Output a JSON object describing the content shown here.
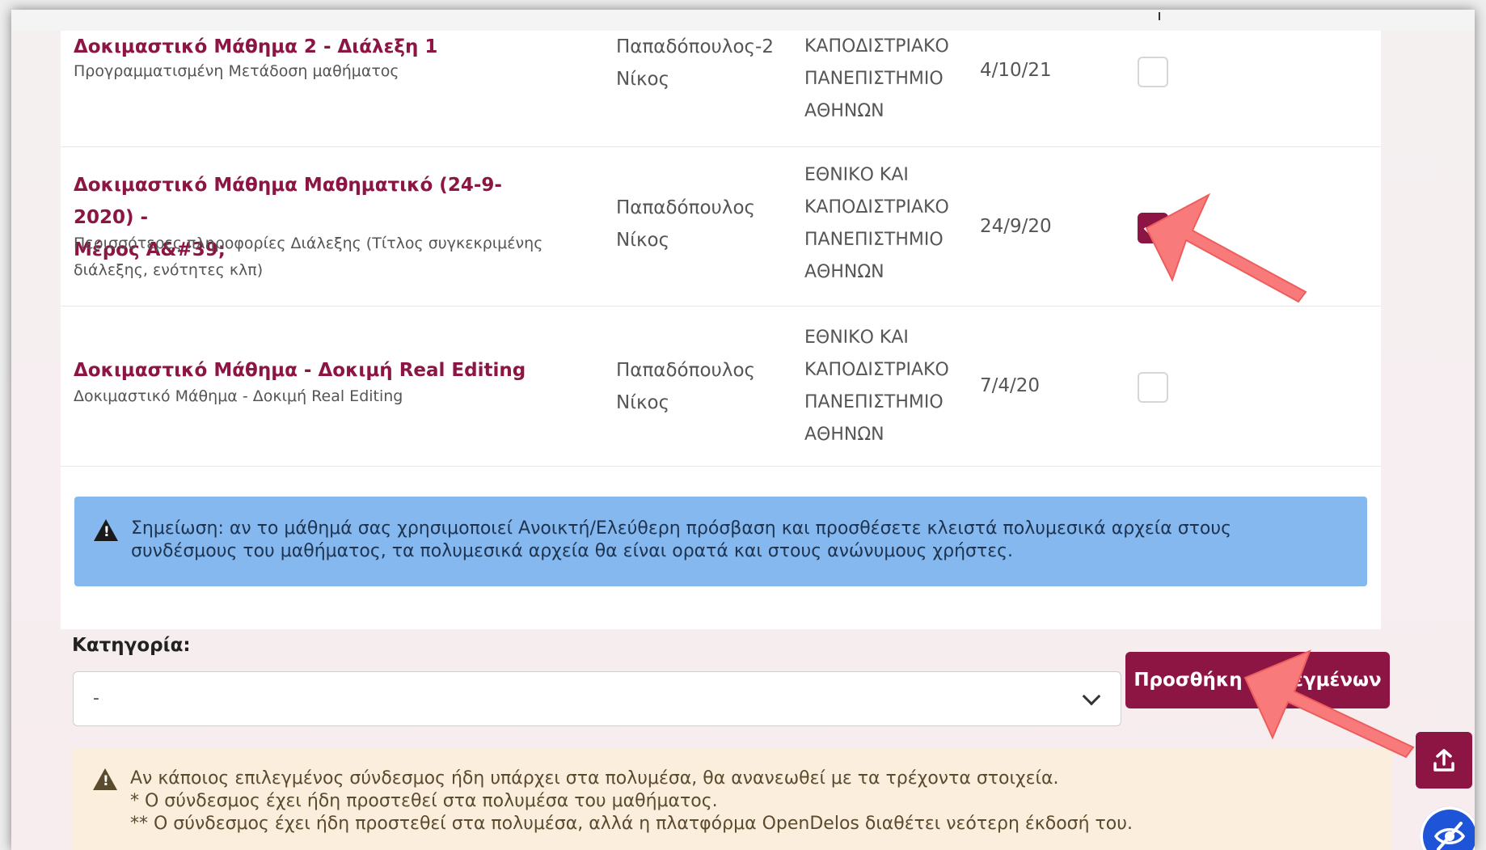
{
  "lectures": [
    {
      "title": "Δοκιμαστικό Μάθημα 2 - Διάλεξη 1",
      "description": "Προγραμματισμένη Μετάδοση μαθήματος",
      "author_lines": [
        "Παπαδόπουλος-2",
        "Νίκος"
      ],
      "institution_lines": [
        "ΚΑΠΟΔΙΣΤΡΙΑΚΟ",
        "ΠΑΝΕΠΙΣΤΗΜΙΟ",
        "ΑΘΗΝΩΝ"
      ],
      "date": "4/10/21",
      "selected": false
    },
    {
      "title_lines": [
        "Δοκιμαστικό Μάθημα Μαθηματικό (24-9-2020) -",
        "Μέρος A&#39;"
      ],
      "description_lines": [
        "Περισσότερες πληροφορίες Διάλεξης (Τίτλος συγκεκριμένης",
        "διάλεξης, ενότητες κλπ)"
      ],
      "author_lines": [
        "Παπαδόπουλος",
        "Νίκος"
      ],
      "institution_lines": [
        "ΕΘΝΙΚΟ ΚΑΙ",
        "ΚΑΠΟΔΙΣΤΡΙΑΚΟ",
        "ΠΑΝΕΠΙΣΤΗΜΙΟ",
        "ΑΘΗΝΩΝ"
      ],
      "date": "24/9/20",
      "selected": true
    },
    {
      "title": "Δοκιμαστικό Μάθημα - Δοκιμή Real Editing",
      "description": "Δοκιμαστικό Μάθημα - Δοκιμή Real Editing",
      "author_lines": [
        "Παπαδόπουλος",
        "Νίκος"
      ],
      "institution_lines": [
        "ΕΘΝΙΚΟ ΚΑΙ",
        "ΚΑΠΟΔΙΣΤΡΙΑΚΟ",
        "ΠΑΝΕΠΙΣΤΗΜΙΟ",
        "ΑΘΗΝΩΝ"
      ],
      "date": "7/4/20",
      "selected": false
    }
  ],
  "info_note": {
    "line1": "Σημείωση: αν το μάθημά σας χρησιμοποιεί Ανοικτή/Ελεύθερη πρόσβαση και προσθέσετε κλειστά πολυμεσικά αρχεία στους",
    "line2": "συνδέσμους του μαθήματος, τα πολυμεσικά αρχεία θα είναι ορατά και στους ανώνυμους χρήστες."
  },
  "category": {
    "label": "Κατηγορία:",
    "selected_value": "-"
  },
  "add_selected_label": "Προσθήκη επιλεγμένων",
  "warning_note": {
    "line1": "Αν κάποιος επιλεγμένος σύνδεσμος ήδη υπάρχει στα πολυμέσα, θα ανανεωθεί με τα τρέχοντα στοιχεία.",
    "line2": "* Ο σύνδεσμος έχει ήδη προστεθεί στα πολυμέσα του μαθήματος.",
    "line3": "** Ο σύνδεσμος έχει ήδη προστεθεί στα πολυμέσα, αλλά η πλατφόρμα OpenDelos διαθέτει νεότερη έκδοσή του."
  },
  "colors": {
    "accent": "#8c1544",
    "info_bg": "#85b8ef",
    "warning_bg": "#fbeedd",
    "annotation_arrow": "#f87a7a",
    "a11y_button": "#1e54d8"
  },
  "icons": {
    "scroll_button": "upload-icon",
    "a11y_button": "eye-slash-icon",
    "notes": "warning-triangle-icon"
  }
}
